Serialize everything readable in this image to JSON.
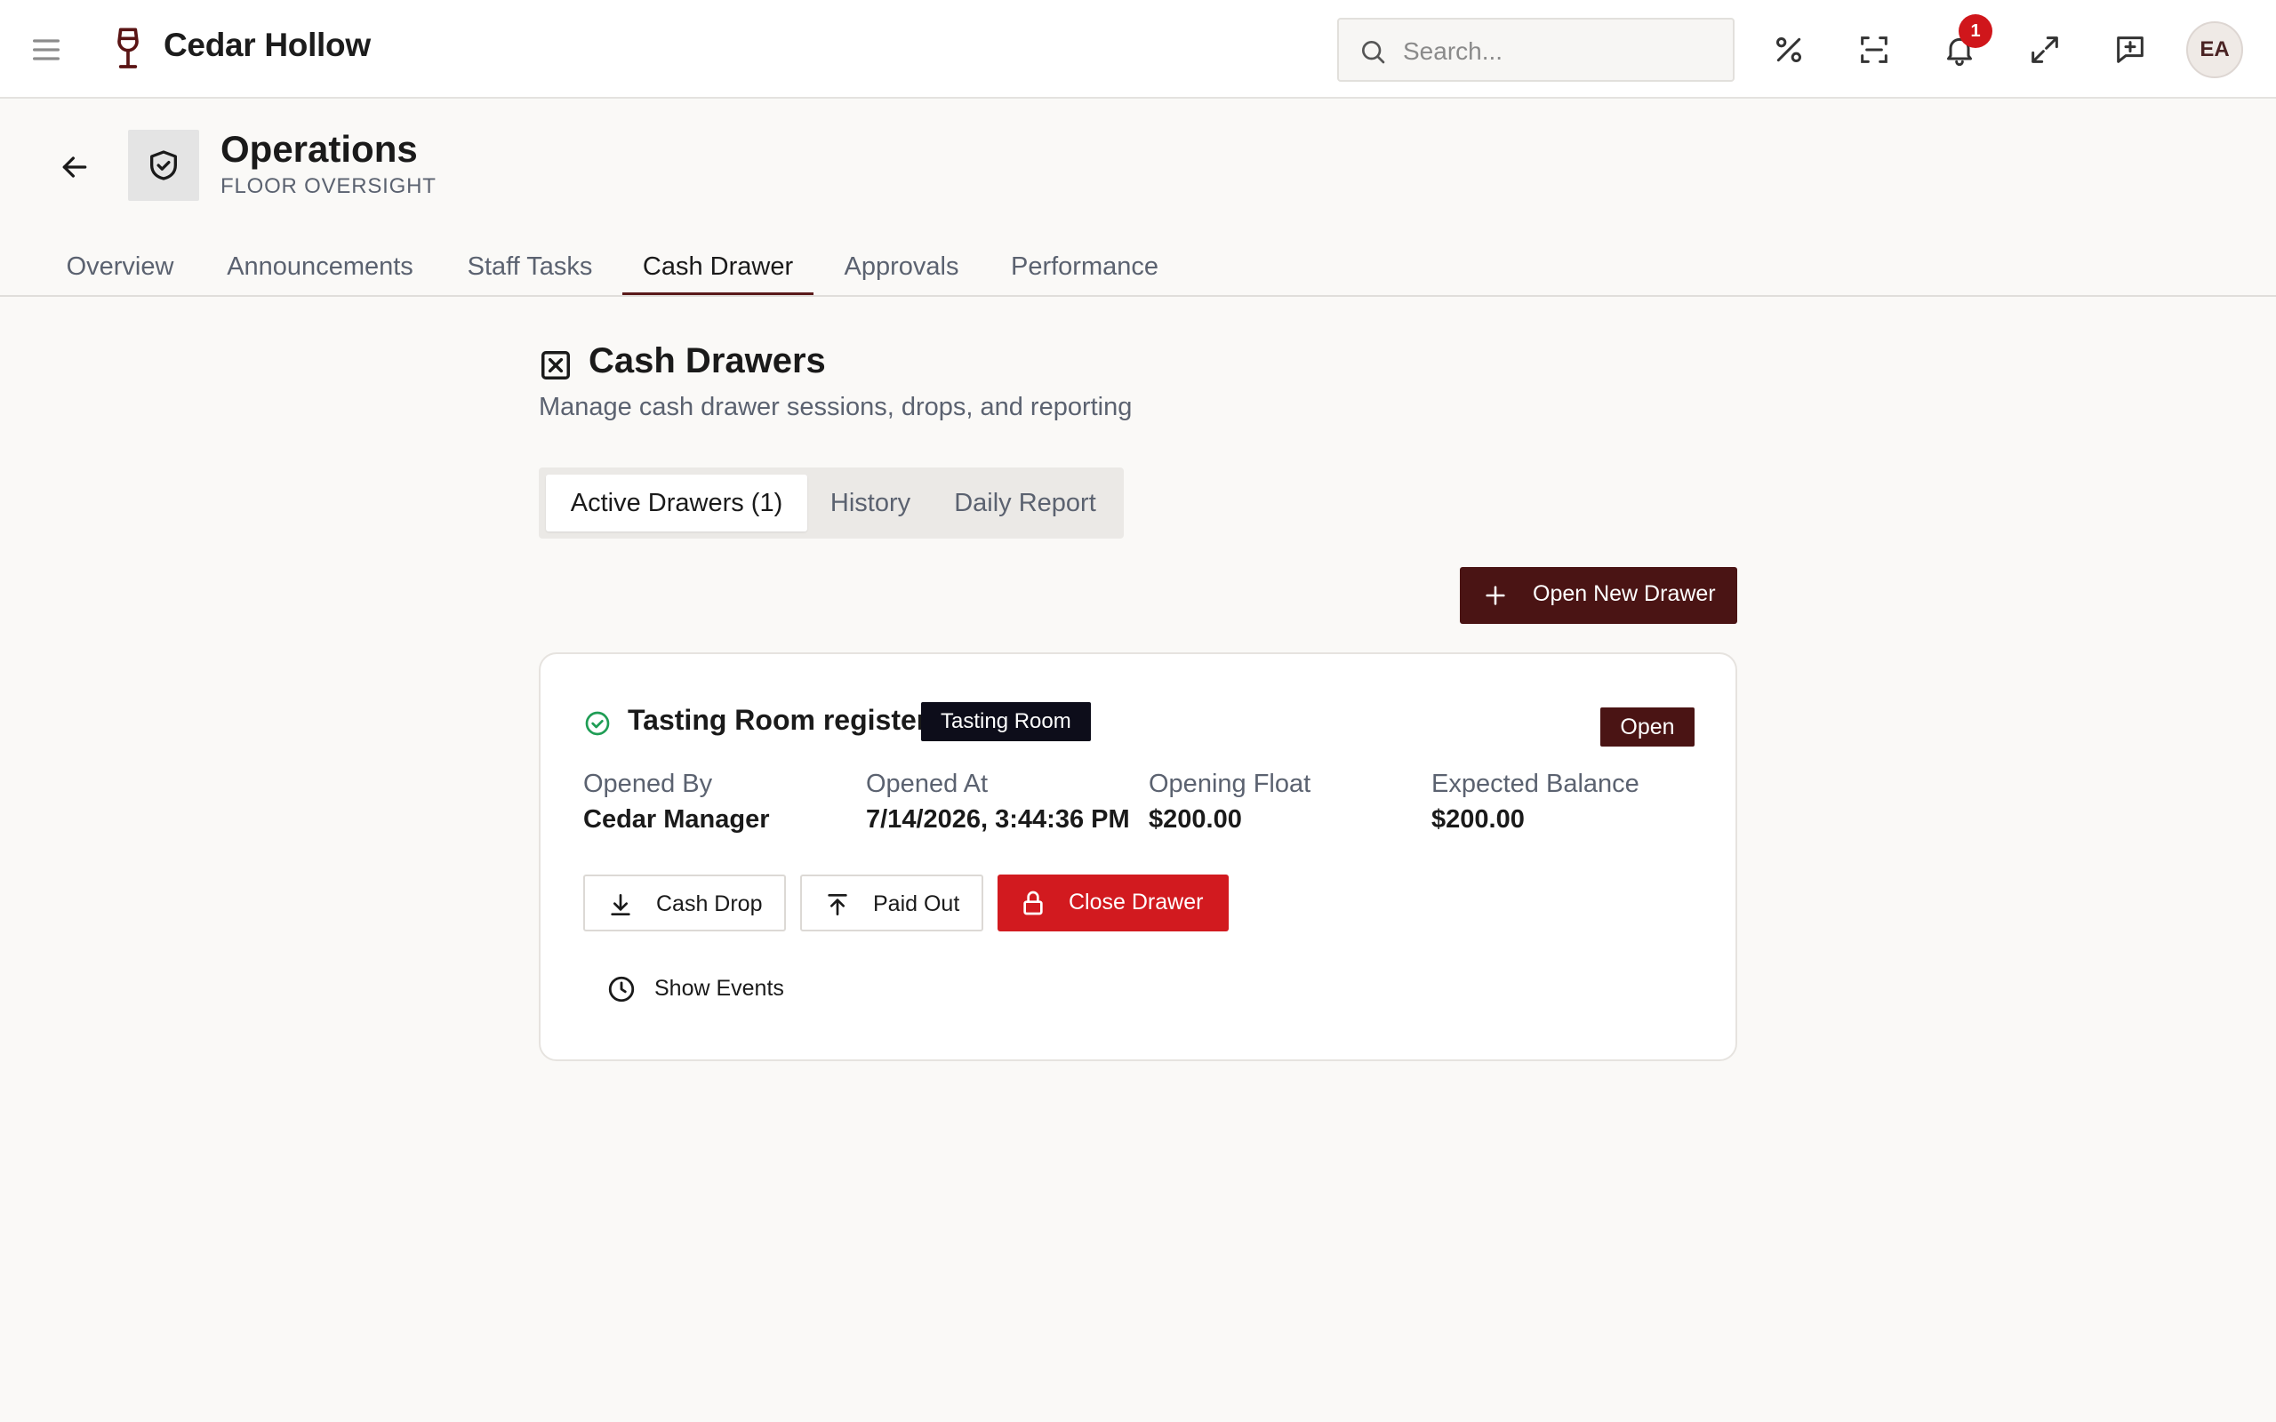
{
  "app": {
    "brand": "Cedar Hollow",
    "search_placeholder": "Search...",
    "notification_count": "1",
    "user_initials": "EA"
  },
  "header": {
    "title": "Operations",
    "subtitle": "FLOOR OVERSIGHT"
  },
  "tabs": [
    {
      "label": "Overview"
    },
    {
      "label": "Announcements"
    },
    {
      "label": "Staff Tasks"
    },
    {
      "label": "Cash Drawer",
      "active": true
    },
    {
      "label": "Approvals"
    },
    {
      "label": "Performance"
    }
  ],
  "section": {
    "title": "Cash Drawers",
    "subtitle": "Manage cash drawer sessions, drops, and reporting"
  },
  "subtabs": [
    {
      "label": "Active Drawers (1)",
      "active": true
    },
    {
      "label": "History"
    },
    {
      "label": "Daily Report"
    }
  ],
  "actions": {
    "open_new": "Open New Drawer"
  },
  "drawer": {
    "name": "Tasting Room register",
    "location": "Tasting Room",
    "status": "Open",
    "fields": [
      {
        "label": "Opened By",
        "value": "Cedar Manager"
      },
      {
        "label": "Opened At",
        "value": "7/14/2026, 3:44:36 PM"
      },
      {
        "label": "Opening Float",
        "value": "$200.00"
      },
      {
        "label": "Expected Balance",
        "value": "$200.00"
      }
    ],
    "buttons": {
      "cash_drop": "Cash Drop",
      "paid_out": "Paid Out",
      "close": "Close Drawer",
      "show_events": "Show Events"
    }
  },
  "colors": {
    "brand": "#4a1414",
    "danger": "#d21a1f",
    "success": "#1f9d55",
    "background": "#faf9f7"
  },
  "icons": [
    "menu-icon",
    "wine-glass-icon",
    "search-icon",
    "percent-icon",
    "scan-icon",
    "bell-icon",
    "expand-icon",
    "feedback-icon",
    "arrow-left-icon",
    "shield-check-icon",
    "cash-drawer-icon",
    "plus-icon",
    "check-circle-icon",
    "download-icon",
    "upload-icon",
    "lock-icon",
    "clock-icon"
  ]
}
